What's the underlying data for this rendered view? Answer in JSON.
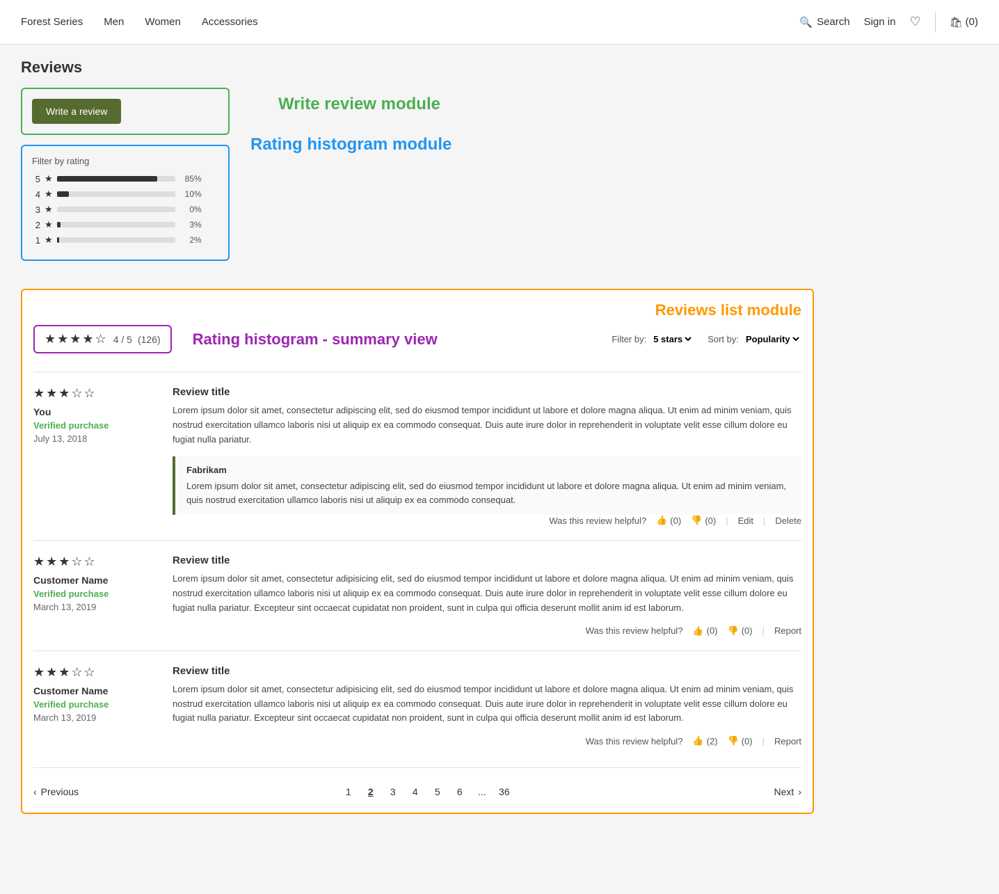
{
  "header": {
    "brand": "Forest Series",
    "nav": [
      "Men",
      "Women",
      "Accessories"
    ],
    "search_label": "Search",
    "sign_in_label": "Sign in",
    "cart_label": "(0)"
  },
  "page": {
    "title": "Reviews"
  },
  "write_review_module": {
    "button_label": "Write a review",
    "module_label": "Write review module"
  },
  "rating_histogram_module": {
    "filter_label": "Filter by rating",
    "module_label": "Rating histogram module",
    "rows": [
      {
        "star": 5,
        "pct_value": 85,
        "pct_label": "85%"
      },
      {
        "star": 4,
        "pct_value": 10,
        "pct_label": "10%"
      },
      {
        "star": 3,
        "pct_value": 0,
        "pct_label": "0%"
      },
      {
        "star": 2,
        "pct_value": 3,
        "pct_label": "3%"
      },
      {
        "star": 1,
        "pct_value": 2,
        "pct_label": "2%"
      }
    ]
  },
  "summary_view": {
    "stars_filled": 4,
    "stars_total": 5,
    "score_label": "4 / 5",
    "count_label": "(126)",
    "label": "Rating histogram - summary view"
  },
  "reviews_list_module": {
    "label": "Reviews list module",
    "filter_by_label": "Filter by:",
    "filter_value": "5 stars",
    "sort_by_label": "Sort by:",
    "sort_value": "Popularity",
    "reviews": [
      {
        "id": 1,
        "stars": 3,
        "reviewer": "You",
        "verified": "Verified purchase",
        "date": "July 13, 2018",
        "title": "Review title",
        "body": "Lorem ipsum dolor sit amet, consectetur adipiscing elit, sed do eiusmod tempor incididunt ut labore et dolore magna aliqua. Ut enim ad minim veniam, quis nostrud exercitation ullamco laboris nisi ut aliquip ex ea commodo consequat. Duis aute irure dolor in reprehenderit in voluptate velit esse cillum dolore eu fugiat nulla pariatur.",
        "helpful_label": "Was this review helpful?",
        "thumbs_up": "(0)",
        "thumbs_down": "(0)",
        "actions": [
          "Edit",
          "Delete"
        ],
        "response": {
          "author": "Fabrikam",
          "body": "Lorem ipsum dolor sit amet, consectetur adipiscing elit, sed do eiusmod tempor incididunt ut labore et dolore magna aliqua. Ut enim ad minim veniam, quis nostrud exercitation ullamco laboris nisi ut aliquip ex ea commodo consequat."
        }
      },
      {
        "id": 2,
        "stars": 3,
        "reviewer": "Customer Name",
        "verified": "Verified purchase",
        "date": "March 13, 2019",
        "title": "Review title",
        "body": "Lorem ipsum dolor sit amet, consectetur adipisicing elit, sed do eiusmod tempor incididunt ut labore et dolore magna aliqua. Ut enim ad minim veniam, quis nostrud exercitation ullamco laboris nisi ut aliquip ex ea commodo consequat. Duis aute irure dolor in reprehenderit in voluptate velit esse cillum dolore eu fugiat nulla pariatur. Excepteur sint occaecat cupidatat non proident, sunt in culpa qui officia deserunt mollit anim id est laborum.",
        "helpful_label": "Was this review helpful?",
        "thumbs_up": "(0)",
        "thumbs_down": "(0)",
        "actions": [
          "Report"
        ],
        "response": null
      },
      {
        "id": 3,
        "stars": 3,
        "reviewer": "Customer Name",
        "verified": "Verified purchase",
        "date": "March 13, 2019",
        "title": "Review title",
        "body": "Lorem ipsum dolor sit amet, consectetur adipisicing elit, sed do eiusmod tempor incididunt ut labore et dolore magna aliqua. Ut enim ad minim veniam, quis nostrud exercitation ullamco laboris nisi ut aliquip ex ea commodo consequat. Duis aute irure dolor in reprehenderit in voluptate velit esse cillum dolore eu fugiat nulla pariatur. Excepteur sint occaecat cupidatat non proident, sunt in culpa qui officia deserunt mollit anim id est laborum.",
        "helpful_label": "Was this review helpful?",
        "thumbs_up": "(2)",
        "thumbs_down": "(0)",
        "actions": [
          "Report"
        ],
        "response": null
      }
    ],
    "pagination": {
      "prev_label": "Previous",
      "next_label": "Next",
      "pages": [
        "1",
        "2",
        "3",
        "4",
        "5",
        "6",
        "...",
        "36"
      ],
      "current_page": "2"
    }
  }
}
